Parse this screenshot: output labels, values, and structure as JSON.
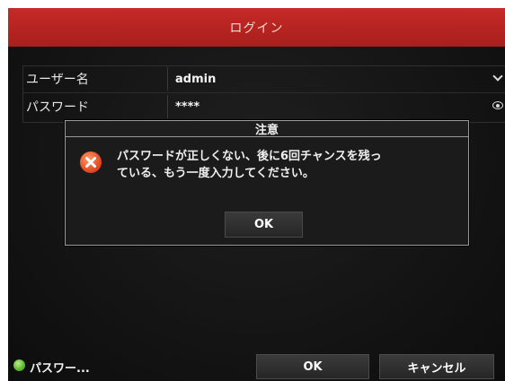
{
  "window": {
    "title": "ログイン"
  },
  "form": {
    "username_label": "ユーザー名",
    "username_value": "admin",
    "password_label": "パスワード",
    "password_value": "****"
  },
  "dialog": {
    "title": "注意",
    "message": "パスワードが正しくない、後に6回チャンスを残っ\nている、もう一度入力してください。",
    "ok_label": "OK",
    "icon": "error-icon"
  },
  "footer": {
    "status_text": "パスワー...",
    "ok_label": "OK",
    "cancel_label": "キャンセル"
  },
  "colors": {
    "title_bar": "#b5231f",
    "status_dot": "#5bb52a",
    "error_icon": "#e54d22"
  }
}
